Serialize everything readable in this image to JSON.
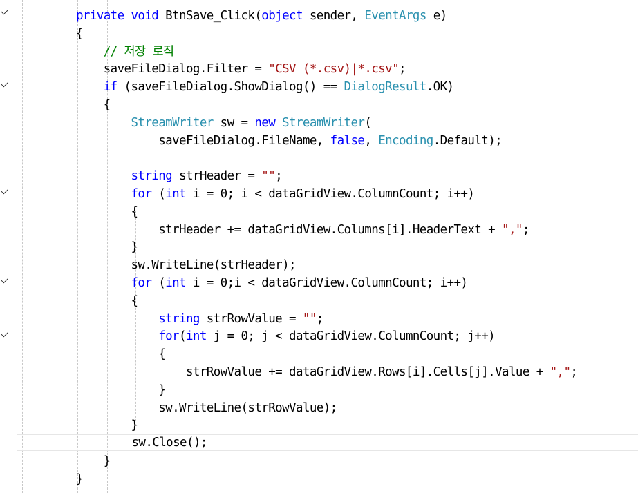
{
  "editor": {
    "lines": [
      {
        "indent": "",
        "tokens": [
          {
            "c": "kw",
            "t": "private"
          },
          {
            "t": " "
          },
          {
            "c": "kw",
            "t": "void"
          },
          {
            "t": " BtnSave_Click("
          },
          {
            "c": "kw",
            "t": "object"
          },
          {
            "t": " sender, "
          },
          {
            "c": "ty",
            "t": "EventArgs"
          },
          {
            "t": " e)"
          }
        ]
      },
      {
        "indent": "",
        "tokens": [
          {
            "t": "{"
          }
        ]
      },
      {
        "indent": "    ",
        "tokens": [
          {
            "c": "cm",
            "t": "// 저장 로직"
          }
        ]
      },
      {
        "indent": "    ",
        "tokens": [
          {
            "t": "saveFileDialog.Filter = "
          },
          {
            "c": "str",
            "t": "\"CSV (*.csv)|*.csv\""
          },
          {
            "t": ";"
          }
        ]
      },
      {
        "indent": "    ",
        "tokens": [
          {
            "c": "kw",
            "t": "if"
          },
          {
            "t": " (saveFileDialog.ShowDialog() == "
          },
          {
            "c": "ty",
            "t": "DialogResult"
          },
          {
            "t": ".OK)"
          }
        ]
      },
      {
        "indent": "    ",
        "tokens": [
          {
            "t": "{"
          }
        ]
      },
      {
        "indent": "        ",
        "tokens": [
          {
            "c": "ty",
            "t": "StreamWriter"
          },
          {
            "t": " sw = "
          },
          {
            "c": "kw",
            "t": "new"
          },
          {
            "t": " "
          },
          {
            "c": "ty",
            "t": "StreamWriter"
          },
          {
            "t": "("
          }
        ]
      },
      {
        "indent": "            ",
        "tokens": [
          {
            "t": "saveFileDialog.FileName, "
          },
          {
            "c": "kw",
            "t": "false"
          },
          {
            "t": ", "
          },
          {
            "c": "ty",
            "t": "Encoding"
          },
          {
            "t": ".Default);"
          }
        ]
      },
      {
        "indent": "",
        "tokens": []
      },
      {
        "indent": "        ",
        "tokens": [
          {
            "c": "kw",
            "t": "string"
          },
          {
            "t": " strHeader = "
          },
          {
            "c": "str",
            "t": "\"\""
          },
          {
            "t": ";"
          }
        ]
      },
      {
        "indent": "        ",
        "tokens": [
          {
            "c": "kw",
            "t": "for"
          },
          {
            "t": " ("
          },
          {
            "c": "kw",
            "t": "int"
          },
          {
            "t": " i = 0; i < dataGridView.ColumnCount; i++)"
          }
        ]
      },
      {
        "indent": "        ",
        "tokens": [
          {
            "t": "{"
          }
        ]
      },
      {
        "indent": "            ",
        "tokens": [
          {
            "t": "strHeader += dataGridView.Columns[i].HeaderText + "
          },
          {
            "c": "str",
            "t": "\",\""
          },
          {
            "t": ";"
          }
        ]
      },
      {
        "indent": "        ",
        "tokens": [
          {
            "t": "}"
          }
        ]
      },
      {
        "indent": "        ",
        "tokens": [
          {
            "t": "sw.WriteLine(strHeader);"
          }
        ]
      },
      {
        "indent": "        ",
        "tokens": [
          {
            "c": "kw",
            "t": "for"
          },
          {
            "t": " ("
          },
          {
            "c": "kw",
            "t": "int"
          },
          {
            "t": " i = 0;i < dataGridView.ColumnCount; i++)"
          }
        ]
      },
      {
        "indent": "        ",
        "tokens": [
          {
            "t": "{"
          }
        ]
      },
      {
        "indent": "            ",
        "tokens": [
          {
            "c": "kw",
            "t": "string"
          },
          {
            "t": " strRowValue = "
          },
          {
            "c": "str",
            "t": "\"\""
          },
          {
            "t": ";"
          }
        ]
      },
      {
        "indent": "            ",
        "tokens": [
          {
            "c": "kw",
            "t": "for"
          },
          {
            "t": "("
          },
          {
            "c": "kw",
            "t": "int"
          },
          {
            "t": " j = 0; j < dataGridView.ColumnCount; j++)"
          }
        ]
      },
      {
        "indent": "            ",
        "tokens": [
          {
            "t": "{"
          }
        ]
      },
      {
        "indent": "                ",
        "tokens": [
          {
            "t": "strRowValue += dataGridView.Rows[i].Cells[j].Value + "
          },
          {
            "c": "str",
            "t": "\",\""
          },
          {
            "t": ";"
          }
        ]
      },
      {
        "indent": "            ",
        "tokens": [
          {
            "t": "}"
          }
        ]
      },
      {
        "indent": "            ",
        "tokens": [
          {
            "t": "sw.WriteLine(strRowValue);"
          }
        ]
      },
      {
        "indent": "        ",
        "tokens": [
          {
            "t": "}"
          }
        ]
      },
      {
        "indent": "        ",
        "tokens": [
          {
            "t": "sw.Close();"
          }
        ],
        "caret": true
      },
      {
        "indent": "    ",
        "tokens": [
          {
            "t": "}"
          }
        ]
      },
      {
        "indent": "",
        "tokens": [
          {
            "t": "}"
          }
        ]
      }
    ]
  },
  "colors": {
    "keyword": "#0000ff",
    "type": "#2b91af",
    "string": "#a31515",
    "comment": "#008000",
    "text": "#000000"
  }
}
